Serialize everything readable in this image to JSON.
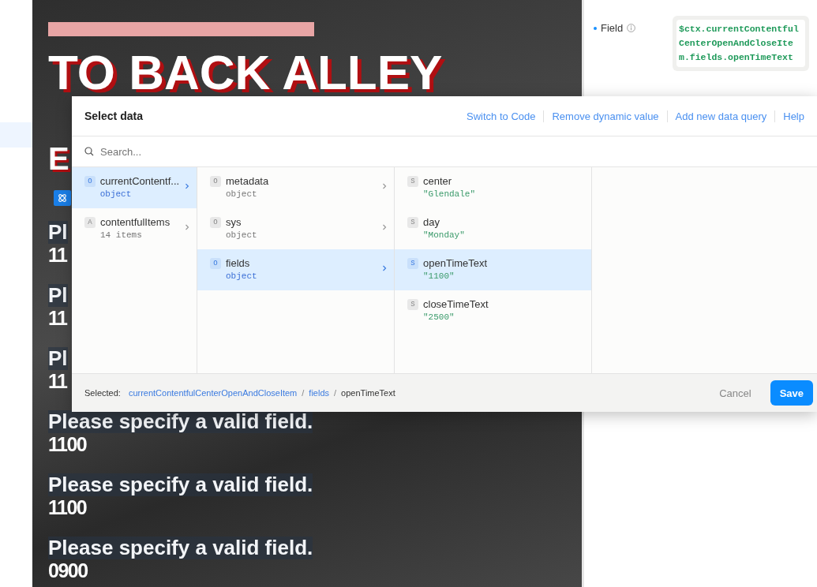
{
  "canvas": {
    "heading": "TO BACK ALLEY",
    "heading_fragment": "E",
    "items": [
      {
        "label": "Pl",
        "value": "11"
      },
      {
        "label": "Pl",
        "value": "11"
      },
      {
        "label": "Pl",
        "value": "11"
      },
      {
        "label": "Please specify a valid field.",
        "value": "1100"
      },
      {
        "label": "Please specify a valid field.",
        "value": "1100"
      },
      {
        "label": "Please specify a valid field.",
        "value": "0900"
      }
    ]
  },
  "properties": {
    "field": {
      "label": "Field",
      "value": "$ctx.currentContentfulCenterOpenAndCloseItem.fields.openTimeText"
    }
  },
  "dialog": {
    "title": "Select data",
    "actions": [
      "Switch to Code",
      "Remove dynamic value",
      "Add new data query",
      "Help"
    ],
    "search": {
      "placeholder": "Search..."
    },
    "columns": [
      [
        {
          "badge": "O",
          "name": "currentContentf...",
          "detail": "object",
          "kind": "object",
          "selected": true,
          "expandable": true
        },
        {
          "badge": "A",
          "name": "contentfulItems",
          "detail": "14 items",
          "kind": "array",
          "selected": false,
          "expandable": true
        }
      ],
      [
        {
          "badge": "O",
          "name": "metadata",
          "detail": "object",
          "kind": "object",
          "selected": false,
          "expandable": true
        },
        {
          "badge": "O",
          "name": "sys",
          "detail": "object",
          "kind": "object",
          "selected": false,
          "expandable": true
        },
        {
          "badge": "O",
          "name": "fields",
          "detail": "object",
          "kind": "object",
          "selected": true,
          "expandable": true
        }
      ],
      [
        {
          "badge": "S",
          "name": "center",
          "detail": "\"Glendale\"",
          "kind": "string",
          "selected": false,
          "expandable": false
        },
        {
          "badge": "S",
          "name": "day",
          "detail": "\"Monday\"",
          "kind": "string",
          "selected": false,
          "expandable": false
        },
        {
          "badge": "S",
          "name": "openTimeText",
          "detail": "\"1100\"",
          "kind": "string",
          "selected": true,
          "expandable": false
        },
        {
          "badge": "S",
          "name": "closeTimeText",
          "detail": "\"2500\"",
          "kind": "string",
          "selected": false,
          "expandable": false
        }
      ]
    ],
    "footer": {
      "label": "Selected:",
      "separator": "/",
      "path": [
        {
          "label": "currentContentfulCenterOpenAndCloseItem",
          "link": true
        },
        {
          "label": "fields",
          "link": true
        },
        {
          "label": "openTimeText",
          "link": false
        }
      ],
      "cancel": "Cancel",
      "save": "Save"
    }
  }
}
